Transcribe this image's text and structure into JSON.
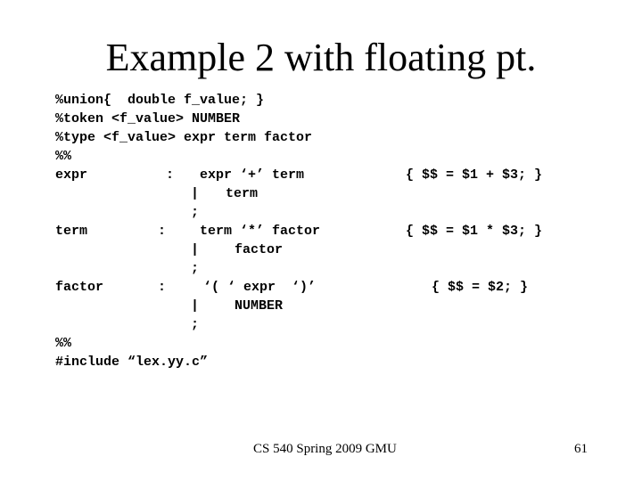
{
  "slide": {
    "title": "Example 2 with floating pt.",
    "declarations": [
      "%union{  double f_value; }",
      "%token <f_value> NUMBER",
      "%type <f_value> expr term factor",
      "%%"
    ],
    "rules": [
      {
        "lhs": "expr",
        "colon": ":",
        "alternatives": [
          "expr ‘+’ term",
          "term"
        ],
        "bar": "|",
        "terminator": ";",
        "action": "{ $$ = $1 + $3; }"
      },
      {
        "lhs": "term",
        "colon": ":",
        "alternatives": [
          "term ‘*’ factor",
          "factor"
        ],
        "bar": "|",
        "terminator": ";",
        "action": "{ $$ = $1 * $3; }"
      },
      {
        "lhs": "factor",
        "colon": ":",
        "alternatives": [
          "‘( ‘ expr  ‘)’",
          "NUMBER"
        ],
        "bar": "|",
        "terminator": ";",
        "action": "{ $$ = $2; }"
      }
    ],
    "trailer": [
      "%%",
      "#include “lex.yy.c”"
    ]
  },
  "footer": {
    "course": "CS 540 Spring 2009 GMU",
    "page_number": "61"
  }
}
